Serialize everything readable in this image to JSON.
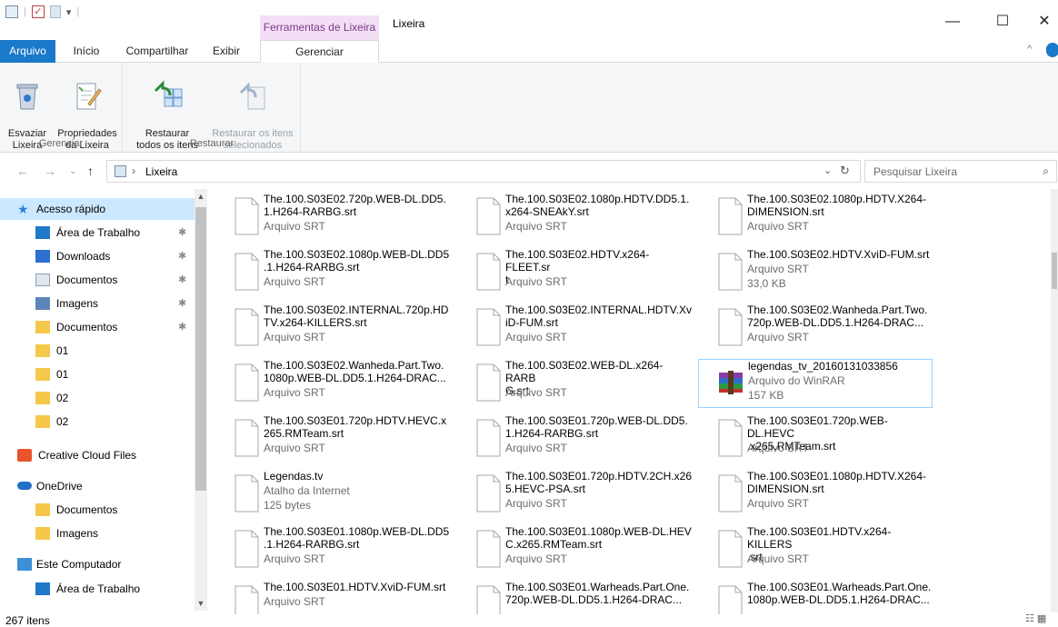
{
  "window": {
    "title": "Lixeira",
    "context_tab": "Ferramentas de Lixeira",
    "controls": {
      "minimize": "—",
      "maximize": "☐",
      "close": "✕"
    }
  },
  "ribbon_tabs": {
    "file": "Arquivo",
    "home": "Início",
    "share": "Compartilhar",
    "view": "Exibir",
    "manage": "Gerenciar"
  },
  "ribbon": {
    "group_manage": {
      "label": "Gerenciar",
      "empty": "Esvaziar\nLixeira",
      "props": "Propriedades\nda Lixeira"
    },
    "group_restore": {
      "label": "Restaurar",
      "restore_all": "Restaurar\ntodos os itens",
      "restore_sel": "Restaurar os itens\nselecionados"
    }
  },
  "address": {
    "path": "Lixeira",
    "search_placeholder": "Pesquisar Lixeira"
  },
  "sidebar": {
    "quick_access": "Acesso rápido",
    "items": [
      {
        "label": "Área de Trabalho",
        "icon": "desktop-icon",
        "pin": true
      },
      {
        "label": "Downloads",
        "icon": "download-icon",
        "pin": true
      },
      {
        "label": "Documentos",
        "icon": "document-icon",
        "pin": true
      },
      {
        "label": "Imagens",
        "icon": "image-icon",
        "pin": true
      },
      {
        "label": "Documentos",
        "icon": "cloud-folder-icon",
        "pin": true
      },
      {
        "label": "01",
        "icon": "folder-icon",
        "pin": false
      },
      {
        "label": "01",
        "icon": "folder-icon",
        "pin": false
      },
      {
        "label": "02",
        "icon": "folder-icon",
        "pin": false
      },
      {
        "label": "02",
        "icon": "folder-icon",
        "pin": false
      }
    ],
    "creative_cloud": "Creative Cloud Files",
    "onedrive": "OneDrive",
    "onedrive_items": [
      "Documentos",
      "Imagens"
    ],
    "this_pc": "Este Computador",
    "pc_items": [
      "Área de Trabalho"
    ]
  },
  "files": [
    {
      "name": "The.100.S03E02.720p.WEB-DL.DD5.\n1.H264-RARBG.srt",
      "type": "Arquivo SRT"
    },
    {
      "name": "The.100.S03E02.1080p.HDTV.DD5.1.\nx264-SNEAkY.srt",
      "type": "Arquivo SRT"
    },
    {
      "name": "The.100.S03E02.1080p.HDTV.X264-\nDIMENSION.srt",
      "type": "Arquivo SRT"
    },
    {
      "name": "The.100.S03E02.1080p.WEB-DL.DD5\n.1.H264-RARBG.srt",
      "type": "Arquivo SRT"
    },
    {
      "name": "The.100.S03E02.HDTV.x264-FLEET.sr\nt",
      "type": "Arquivo SRT"
    },
    {
      "name": "The.100.S03E02.HDTV.XviD-FUM.srt",
      "type": "Arquivo SRT",
      "size": "33,0 KB"
    },
    {
      "name": "The.100.S03E02.INTERNAL.720p.HD\nTV.x264-KILLERS.srt",
      "type": "Arquivo SRT"
    },
    {
      "name": "The.100.S03E02.INTERNAL.HDTV.Xv\niD-FUM.srt",
      "type": "Arquivo SRT"
    },
    {
      "name": "The.100.S03E02.Wanheda.Part.Two.\n720p.WEB-DL.DD5.1.H264-DRAC...",
      "type": "Arquivo SRT"
    },
    {
      "name": "The.100.S03E02.Wanheda.Part.Two.\n1080p.WEB-DL.DD5.1.H264-DRAC...",
      "type": "Arquivo SRT"
    },
    {
      "name": "The.100.S03E02.WEB-DL.x264-RARB\nG.srt",
      "type": "Arquivo SRT"
    },
    {
      "name": "legendas_tv_20160131033856",
      "type": "Arquivo do WinRAR",
      "size": "157 KB",
      "icon": "winrar-icon",
      "selected": true
    },
    {
      "name": "The.100.S03E01.720p.HDTV.HEVC.x\n265.RMTeam.srt",
      "type": "Arquivo SRT"
    },
    {
      "name": "The.100.S03E01.720p.WEB-DL.DD5.\n1.H264-RARBG.srt",
      "type": "Arquivo SRT"
    },
    {
      "name": "The.100.S03E01.720p.WEB-DL.HEVC\n.x265.RMTeam.srt",
      "type": "Arquivo SRT"
    },
    {
      "name": "Legendas.tv",
      "type": "Atalho da Internet",
      "size": "125 bytes",
      "icon": "shortcut-icon"
    },
    {
      "name": "The.100.S03E01.720p.HDTV.2CH.x26\n5.HEVC-PSA.srt",
      "type": "Arquivo SRT"
    },
    {
      "name": "The.100.S03E01.1080p.HDTV.X264-\nDIMENSION.srt",
      "type": "Arquivo SRT"
    },
    {
      "name": "The.100.S03E01.1080p.WEB-DL.DD5\n.1.H264-RARBG.srt",
      "type": "Arquivo SRT"
    },
    {
      "name": "The.100.S03E01.1080p.WEB-DL.HEV\nC.x265.RMTeam.srt",
      "type": "Arquivo SRT"
    },
    {
      "name": "The.100.S03E01.HDTV.x264-KILLERS\n.srt",
      "type": "Arquivo SRT"
    },
    {
      "name": "The.100.S03E01.HDTV.XviD-FUM.srt",
      "type": "Arquivo SRT"
    },
    {
      "name": "The.100.S03E01.Warheads.Part.One.\n720p.WEB-DL.DD5.1.H264-DRAC...",
      "type": ""
    },
    {
      "name": "The.100.S03E01.Warheads.Part.One.\n1080p.WEB-DL.DD5.1.H264-DRAC...",
      "type": ""
    }
  ],
  "status": {
    "count": "267 itens"
  },
  "colors": {
    "accent": "#1979ca",
    "context_tab_bg": "#f3dff5",
    "selection": "#cce8ff"
  }
}
